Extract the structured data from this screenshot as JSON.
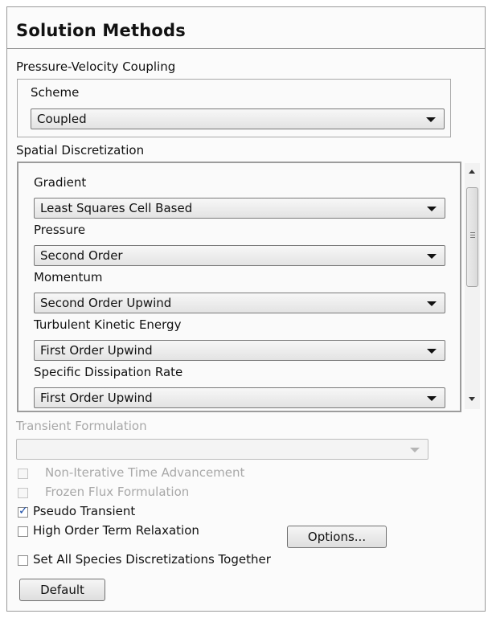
{
  "panel": {
    "title": "Solution Methods"
  },
  "pressure_velocity": {
    "section_label": "Pressure-Velocity Coupling",
    "scheme_label": "Scheme",
    "scheme_value": "Coupled"
  },
  "spatial": {
    "section_label": "Spatial Discretization",
    "items": [
      {
        "label": "Gradient",
        "value": "Least Squares Cell Based"
      },
      {
        "label": "Pressure",
        "value": "Second Order"
      },
      {
        "label": "Momentum",
        "value": "Second Order Upwind"
      },
      {
        "label": "Turbulent Kinetic Energy",
        "value": "First Order Upwind"
      },
      {
        "label": "Specific Dissipation Rate",
        "value": "First Order Upwind"
      }
    ]
  },
  "transient": {
    "section_label": "Transient Formulation",
    "value": ""
  },
  "options": [
    {
      "label": "Non-Iterative Time Advancement",
      "checked": false,
      "enabled": false
    },
    {
      "label": "Frozen Flux Formulation",
      "checked": false,
      "enabled": false
    },
    {
      "label": "Pseudo Transient",
      "checked": true,
      "enabled": true
    },
    {
      "label": "High Order Term Relaxation",
      "checked": false,
      "enabled": true
    },
    {
      "label": "Set All Species Discretizations Together",
      "checked": false,
      "enabled": true
    }
  ],
  "buttons": {
    "options_label": "Options...",
    "default_label": "Default"
  },
  "icons": {
    "dropdown": "chevron-down-icon",
    "scroll_up": "scroll-up-arrow-icon",
    "scroll_down": "scroll-down-arrow-icon",
    "checkmark": "checkmark-icon"
  }
}
